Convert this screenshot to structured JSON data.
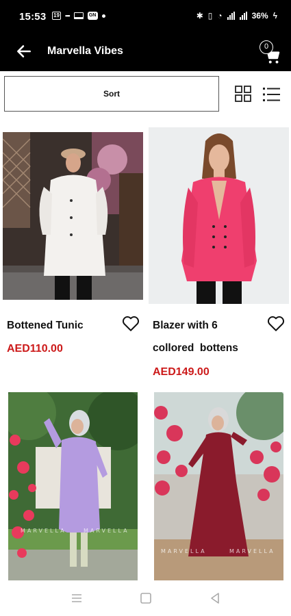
{
  "status_bar": {
    "time": "15:53",
    "battery": "36%",
    "badge_icon": "calendar-icon",
    "fill_icon_text": "GN"
  },
  "app_bar": {
    "title": "Marvella Vibes",
    "cart_count": "0",
    "back_icon": "arrow-left-icon",
    "cart_icon": "shopping-cart-icon"
  },
  "toolbar": {
    "sort_label": "Sort",
    "grid_icon": "grid-view-icon",
    "list_icon": "list-view-icon"
  },
  "products": [
    {
      "name_lines": [
        "Bottened Tunic"
      ],
      "price": "AED110.00"
    },
    {
      "name_lines": [
        "Blazer with 6",
        "collored  bottens"
      ],
      "price": "AED149.00"
    },
    {
      "name_lines": [],
      "price": ""
    },
    {
      "name_lines": [],
      "price": ""
    }
  ],
  "watermark": "MARVELLA",
  "colors": {
    "price": "#cc1a1a",
    "app_bar": "#000000",
    "tunic": "#f3f1ee",
    "blazer": "#ef3f6e",
    "purple_dress": "#b49be0",
    "red_dress": "#8a1b2c"
  }
}
